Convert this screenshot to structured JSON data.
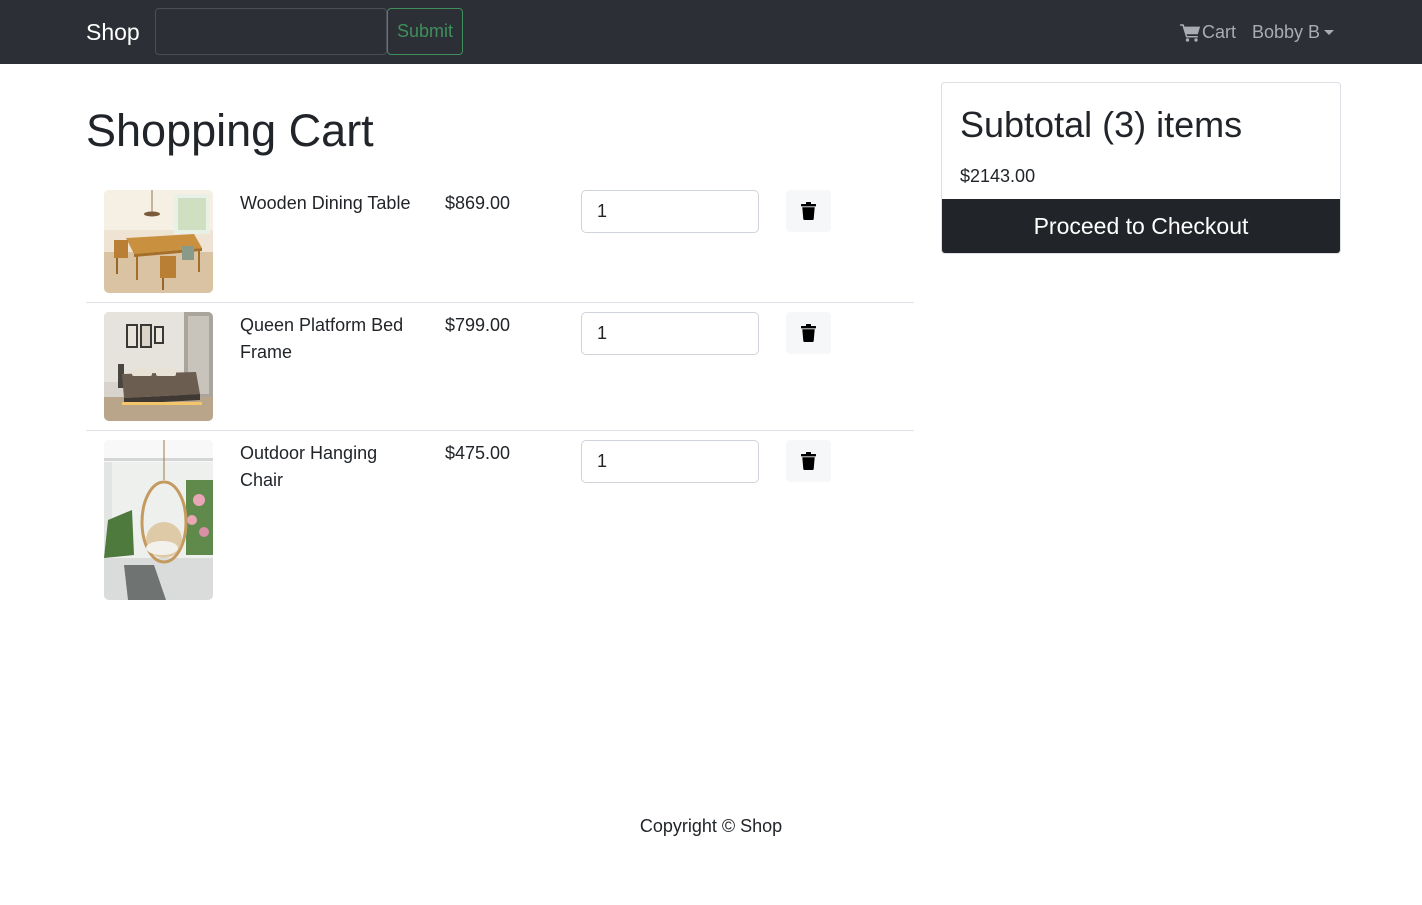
{
  "navbar": {
    "brand": "Shop",
    "search": {
      "value": "",
      "placeholder": ""
    },
    "submit_label": "Submit",
    "cart_label": "Cart",
    "user_label": "Bobby B"
  },
  "page": {
    "title": "Shopping Cart"
  },
  "cart": {
    "items": [
      {
        "name": "Wooden Dining Table",
        "price": "$869.00",
        "quantity": "1",
        "image": "dining-table-photo"
      },
      {
        "name": "Queen Platform Bed Frame",
        "price": "$799.00",
        "quantity": "1",
        "image": "bed-frame-photo"
      },
      {
        "name": "Outdoor Hanging Chair",
        "price": "$475.00",
        "quantity": "1",
        "image": "hanging-chair-photo"
      }
    ]
  },
  "summary": {
    "title": "Subtotal (3) items",
    "total": "$2143.00",
    "checkout_label": "Proceed to Checkout"
  },
  "footer": {
    "text": "Copyright © Shop"
  },
  "colors": {
    "navbar_bg": "#2c2f35",
    "submit_accent": "#3f8f5c",
    "checkout_bg": "#212529"
  }
}
